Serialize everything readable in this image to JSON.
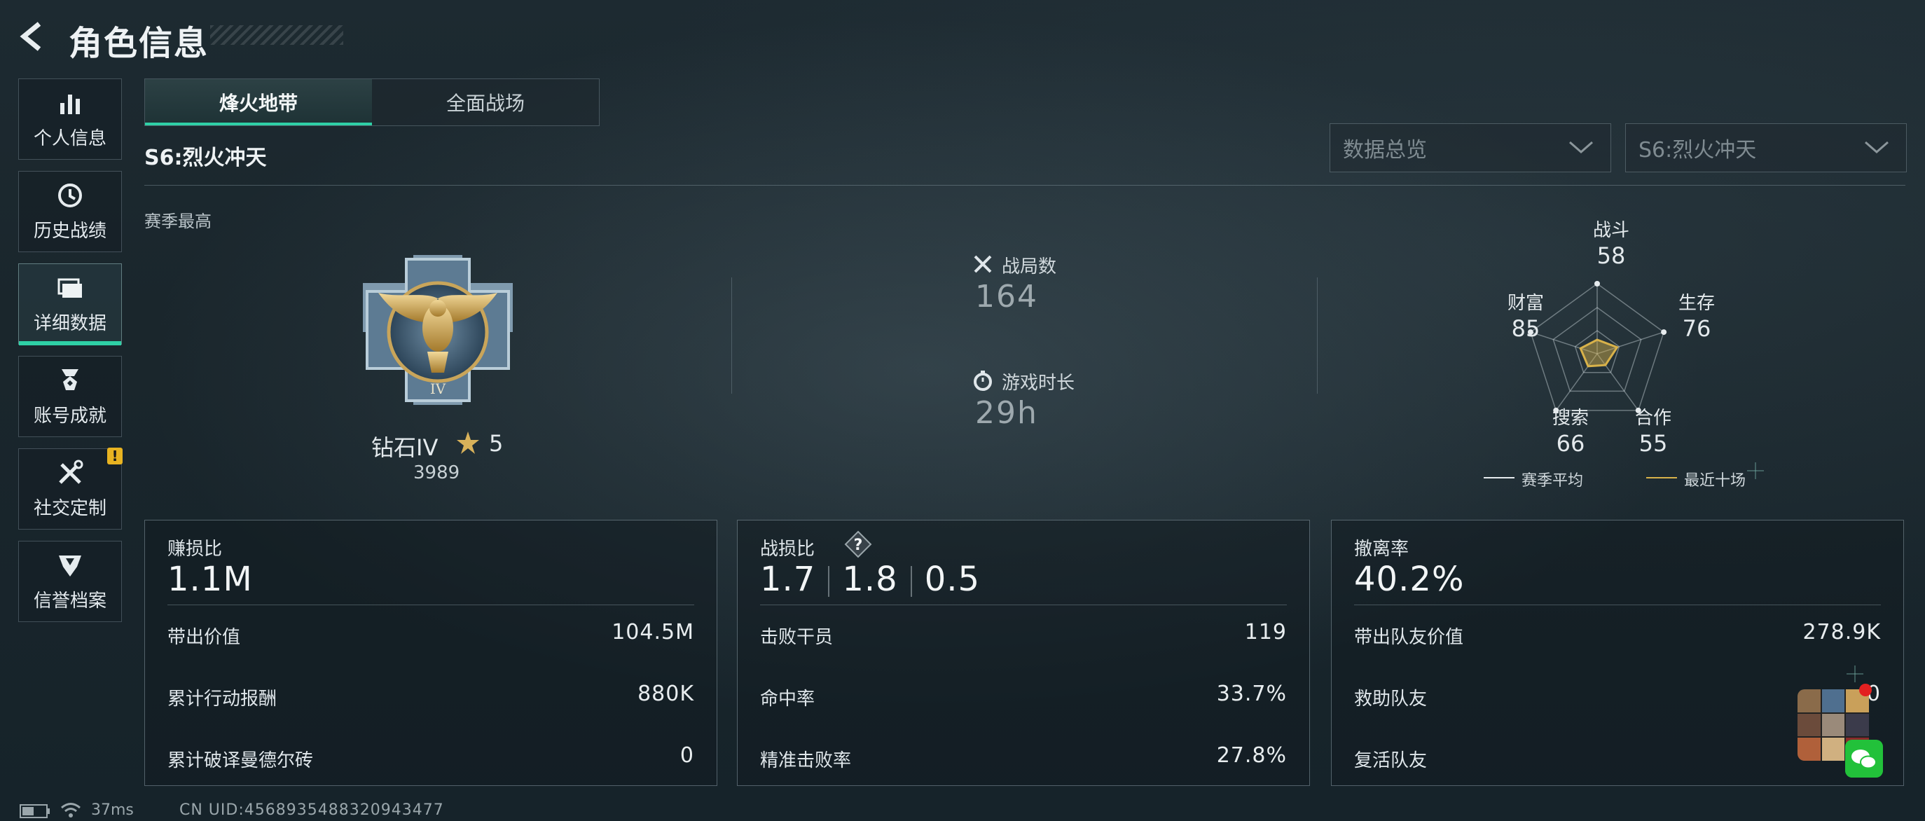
{
  "header": {
    "title": "角色信息"
  },
  "sidebar": {
    "items": [
      {
        "label": "个人信息",
        "icon": "bar-chart-icon"
      },
      {
        "label": "历史战绩",
        "icon": "history-clock-icon"
      },
      {
        "label": "详细数据",
        "icon": "folder-stack-icon",
        "active": true
      },
      {
        "label": "账号成就",
        "icon": "medal-icon"
      },
      {
        "label": "社交定制",
        "icon": "tools-icon",
        "badge": "!"
      },
      {
        "label": "信誉档案",
        "icon": "shield-emblem-icon"
      }
    ]
  },
  "tabs": [
    {
      "label": "烽火地带",
      "active": true
    },
    {
      "label": "全面战场",
      "active": false
    }
  ],
  "season": {
    "name": "S6:烈火冲天",
    "best_label": "赛季最高"
  },
  "filters": {
    "data_select": "数据总览",
    "season_select": "S6:烈火冲天"
  },
  "rank": {
    "name": "钻石IV",
    "stars": "5",
    "points": "3989"
  },
  "summary": {
    "matches_label": "战局数",
    "matches_value": "164",
    "playtime_label": "游戏时长",
    "playtime_value": "29h"
  },
  "radar": {
    "axes": [
      {
        "label": "战斗",
        "value": "58"
      },
      {
        "label": "生存",
        "value": "76"
      },
      {
        "label": "合作",
        "value": "55"
      },
      {
        "label": "搜索",
        "value": "66"
      },
      {
        "label": "财富",
        "value": "85"
      }
    ],
    "legend": [
      {
        "label": "赛季平均",
        "color": "#e6ebee"
      },
      {
        "label": "最近十场",
        "color": "#d8b24a"
      }
    ],
    "max": 100,
    "recent_values": [
      20,
      30,
      20,
      22,
      25
    ]
  },
  "cards": [
    {
      "head_label": "赚损比",
      "head_value": "1.1M",
      "rows": [
        {
          "label": "带出价值",
          "value": "104.5M"
        },
        {
          "label": "累计行动报酬",
          "value": "880K"
        },
        {
          "label": "累计破译曼德尔砖",
          "value": "0"
        }
      ]
    },
    {
      "head_label": "战损比",
      "head_values": [
        "1.7",
        "1.8",
        "0.5"
      ],
      "rows": [
        {
          "label": "击败干员",
          "value": "119"
        },
        {
          "label": "命中率",
          "value": "33.7%"
        },
        {
          "label": "精准击败率",
          "value": "27.8%"
        }
      ]
    },
    {
      "head_label": "撤离率",
      "head_value": "40.2%",
      "rows": [
        {
          "label": "带出队友价值",
          "value": "278.9K"
        },
        {
          "label": "救助队友",
          "value": "0"
        },
        {
          "label": "复活队友",
          "value": ""
        }
      ]
    }
  ],
  "footer": {
    "ping": "37ms",
    "uid": "CN UID:4568935488320943477"
  },
  "colors": {
    "accent": "#2fd0a6",
    "warning": "#e8b321",
    "gold": "#d8b24a"
  }
}
